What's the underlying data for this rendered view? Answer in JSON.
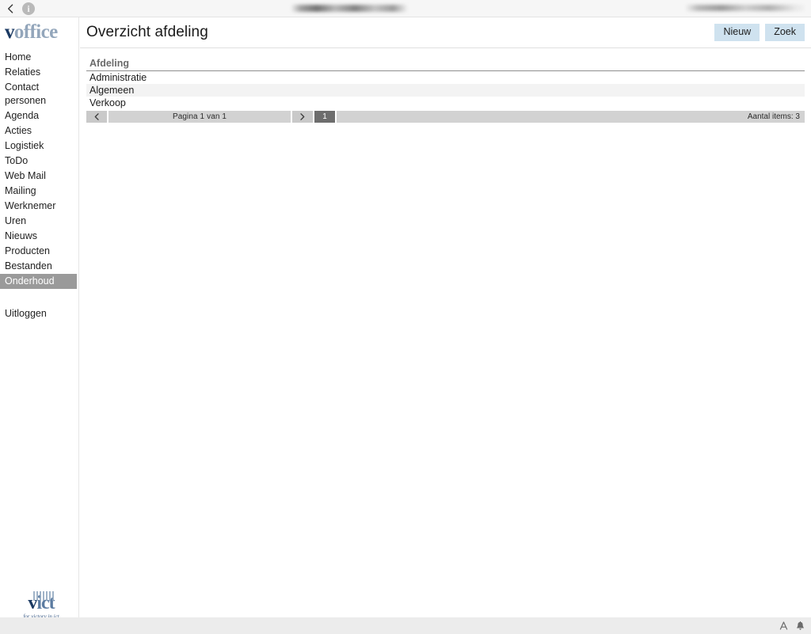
{
  "chrome": {
    "back_icon": "chevron-left-icon",
    "info_icon": "info-circle-icon",
    "info_glyph": "i",
    "title_redacted": "",
    "address_redacted": ""
  },
  "sidebar": {
    "logo": {
      "first": "v",
      "rest": "office"
    },
    "items": [
      {
        "label": "Home",
        "active": false
      },
      {
        "label": "Relaties",
        "active": false
      },
      {
        "label": "Contact\npersonen",
        "active": false
      },
      {
        "label": "Agenda",
        "active": false
      },
      {
        "label": "Acties",
        "active": false
      },
      {
        "label": "Logistiek",
        "active": false
      },
      {
        "label": "ToDo",
        "active": false
      },
      {
        "label": "Web Mail",
        "active": false
      },
      {
        "label": "Mailing",
        "active": false
      },
      {
        "label": "Werknemer",
        "active": false
      },
      {
        "label": "Uren",
        "active": false
      },
      {
        "label": "Nieuws",
        "active": false
      },
      {
        "label": "Producten",
        "active": false
      },
      {
        "label": "Bestanden",
        "active": false
      },
      {
        "label": "Onderhoud",
        "active": true
      }
    ],
    "logout": {
      "label": "Uitloggen"
    },
    "footer_logo": {
      "first": "v",
      "rest": "ict",
      "tagline": "for victory in ict"
    }
  },
  "header": {
    "title": "Overzicht afdeling",
    "buttons": [
      {
        "label": "Nieuw",
        "name": "new-button"
      },
      {
        "label": "Zoek",
        "name": "search-button"
      }
    ]
  },
  "table": {
    "columns": [
      "Afdeling"
    ],
    "rows": [
      [
        "Administratie"
      ],
      [
        "Algemeen"
      ],
      [
        "Verkoop"
      ]
    ]
  },
  "pagination": {
    "prev_icon": "chevron-left-icon",
    "next_icon": "chevron-right-icon",
    "page_label": "Pagina 1 van 1",
    "current_page": "1",
    "item_count_label": "Aantal items: 3"
  },
  "footer": {
    "font_icon_glyph": "A",
    "bell_icon": "bell-icon"
  },
  "colors": {
    "accent_button": "#cfe2ef",
    "active_nav": "#9a9a9a",
    "logo_dark": "#1b3a63",
    "logo_light": "#93a6bb",
    "pager_track": "#d2d2d2",
    "pager_current": "#6d6d6d"
  }
}
